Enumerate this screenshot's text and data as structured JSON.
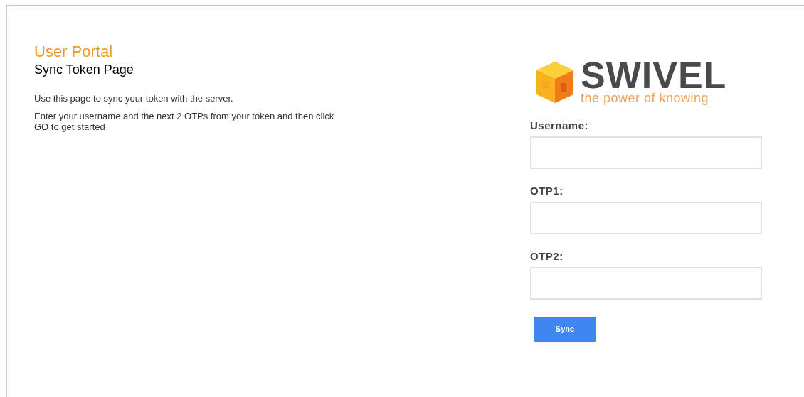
{
  "header": {
    "title": "User Portal",
    "subtitle": "Sync Token Page"
  },
  "intro": [
    "Use this page to sync your token with the server.",
    "Enter your username and the next 2 OTPs from your token and then click GO to get started"
  ],
  "logo": {
    "name": "SWIVEL",
    "tagline": "the power of knowing"
  },
  "fields": [
    {
      "label": "Username:"
    },
    {
      "label": "OTP1:"
    },
    {
      "label": "OTP2:"
    }
  ],
  "button": "Sync"
}
